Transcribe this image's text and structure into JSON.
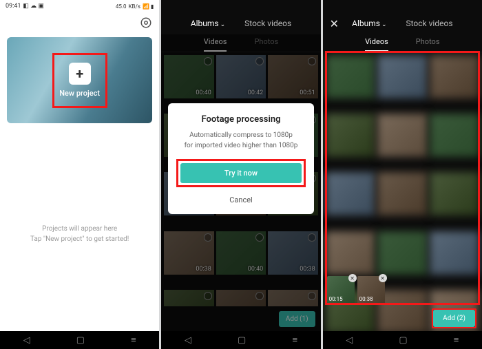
{
  "status": {
    "time": "09:41",
    "net": "45.0",
    "unit": "KB/s"
  },
  "screen1": {
    "new_project": "New project",
    "empty_line1": "Projects will appear here",
    "empty_line2": "Tap \"New project\" to get started!"
  },
  "topbar": {
    "albums": "Albums",
    "stock": "Stock videos",
    "sub_videos": "Videos",
    "sub_photos": "Photos"
  },
  "grid2": {
    "durations": [
      "00:40",
      "00:42",
      "00:51",
      "",
      "",
      "",
      "",
      "",
      "",
      "00:38",
      "00:40",
      "00:38",
      "",
      "",
      ""
    ]
  },
  "dialog": {
    "title": "Footage processing",
    "msg_l1": "Automatically compress to 1080p",
    "msg_l2": "for imported video higher than 1080p",
    "try": "Try it now",
    "cancel": "Cancel"
  },
  "addbar2": {
    "label": "Add (1)"
  },
  "addbar3": {
    "label": "Add (2)"
  },
  "selected": [
    {
      "dur": "00:15"
    },
    {
      "dur": "00:38"
    }
  ]
}
